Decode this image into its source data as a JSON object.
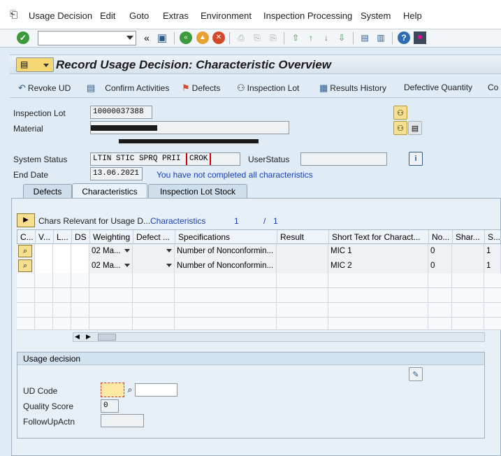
{
  "menu": {
    "items": [
      "Usage Decision",
      "Edit",
      "Goto",
      "Extras",
      "Environment",
      "Inspection Processing",
      "System",
      "Help"
    ]
  },
  "window": {
    "title": "Record Usage Decision: Characteristic Overview"
  },
  "app_toolbar": {
    "revoke": "Revoke UD",
    "confirm": "Confirm Activities",
    "defects": "Defects",
    "inspection_lot": "Inspection Lot",
    "results_history": "Results History",
    "defective_quantity": "Defective Quantity",
    "more": "Co"
  },
  "header": {
    "inspection_lot_label": "Inspection Lot",
    "inspection_lot_value": "10000037388",
    "material_label": "Material",
    "system_status_label": "System Status",
    "system_status_value": "LTIN STIC SPRQ PRII",
    "system_status_highlight": "CROK",
    "user_status_label": "UserStatus",
    "end_date_label": "End Date",
    "end_date_value": "13.06.2021",
    "message": "You have not completed all characteristics"
  },
  "tabs": [
    {
      "label": "Defects"
    },
    {
      "label": "Characteristics"
    },
    {
      "label": "Inspection Lot Stock"
    }
  ],
  "chars_bar": {
    "label": "Chars Relevant for Usage D...",
    "dropdown": "Characteristics",
    "page": "1",
    "separator": "/",
    "total": "1"
  },
  "table": {
    "columns": [
      "C...",
      "V...",
      "L...",
      "DS",
      "Weighting",
      "Defect ...",
      "Specifications",
      "Result",
      "Short Text for Charact...",
      "No...",
      "Shar...",
      "S..."
    ],
    "rows": [
      {
        "weighting": "02 Ma...",
        "defect": "",
        "specifications": "Number of Nonconformin...",
        "result": "",
        "short_text": "MIC 1",
        "no": "0",
        "share": "",
        "s": "1"
      },
      {
        "weighting": "02 Ma...",
        "defect": "",
        "specifications": "Number of Nonconformin...",
        "result": "",
        "short_text": "MIC 2",
        "no": "0",
        "share": "",
        "s": "1"
      }
    ]
  },
  "usage_decision": {
    "title": "Usage decision",
    "ud_code_label": "UD Code",
    "ud_code_value": "",
    "quality_score_label": "Quality Score",
    "quality_score_value": "0",
    "follow_up_label": "FollowUpActn",
    "follow_up_value": ""
  },
  "colors": {
    "background": "#dfebf5",
    "highlight_border": "#cc0000",
    "message_text": "#1a3fb5",
    "input_yellow": "#fde9a4"
  }
}
